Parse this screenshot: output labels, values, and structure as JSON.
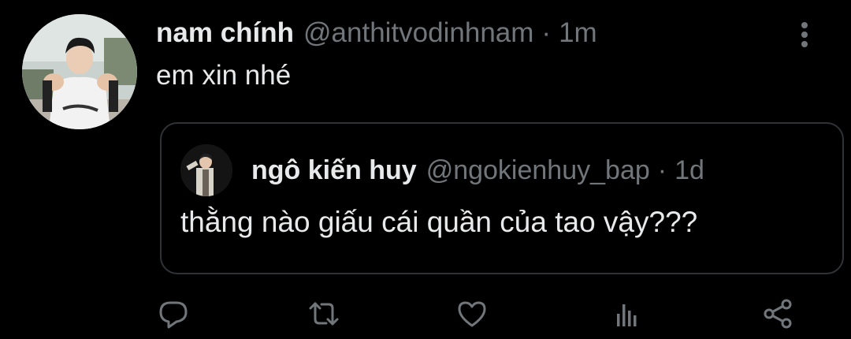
{
  "tweet": {
    "display_name": "nam chính",
    "handle": "@anthitvodinhnam",
    "separator": "·",
    "time": "1m",
    "text": "em xin nhé"
  },
  "quoted": {
    "display_name": "ngô kiến huy",
    "handle": "@ngokienhuy_bap",
    "separator": "·",
    "time": "1d",
    "text": "thằng nào giấu cái quần của tao vậy???"
  },
  "actions": [
    {
      "icon": "reply-icon"
    },
    {
      "icon": "retweet-icon"
    },
    {
      "icon": "like-icon"
    },
    {
      "icon": "analytics-icon"
    },
    {
      "icon": "share-icon"
    }
  ],
  "colors": {
    "background": "#000000",
    "text": "#e7e9ea",
    "secondary": "#71767b",
    "border": "#2f3336"
  }
}
